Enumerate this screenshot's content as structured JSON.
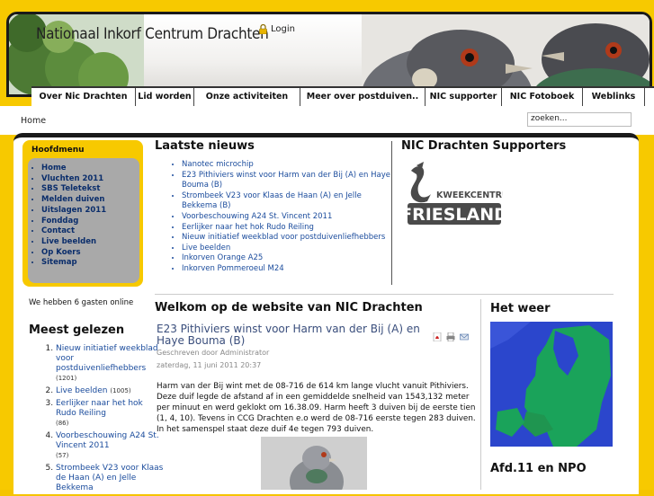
{
  "header": {
    "site_title": "Nationaal Inkorf Centrum Drachten",
    "login_label": "Login"
  },
  "nav": {
    "items": [
      {
        "label": "Over Nic Drachten"
      },
      {
        "label": "Lid worden"
      },
      {
        "label": "Onze activiteiten"
      },
      {
        "label": "Meer over postduiven.."
      },
      {
        "label": "NIC supporter"
      },
      {
        "label": "NIC Fotoboek"
      },
      {
        "label": "Weblinks"
      }
    ]
  },
  "breadcrumb": "Home",
  "search": {
    "value": "zoeken..."
  },
  "main_menu": {
    "title": "Hoofdmenu",
    "items": [
      "Home",
      "Vluchten 2011",
      "SBS Teletekst",
      "Melden duiven",
      "Uitslagen 2011",
      "Fonddag",
      "Contact",
      "Live beelden",
      "Op Koers",
      "Sitemap"
    ]
  },
  "guests_text": "We hebben 6 gasten online",
  "popular": {
    "title": "Meest gelezen",
    "items": [
      {
        "label": "Nieuw initiatief weekblad voor postduivenliefhebbers",
        "count": "(1201)"
      },
      {
        "label": "Live beelden",
        "count": "(1005)"
      },
      {
        "label": "Eerlijker naar het hok Rudo Reiling",
        "count": "(86)"
      },
      {
        "label": "Voorbeschouwing A24 St. Vincent 2011",
        "count": "(57)"
      },
      {
        "label": "Strombeek V23 voor Klaas de Haan (A) en Jelle Bekkema",
        "count": ""
      }
    ]
  },
  "latest_news": {
    "title": "Laatste nieuws",
    "items": [
      "Nanotec microchip",
      "E23 Pithiviers winst voor Harm van der Bij (A) en Haye Bouma (B)",
      "Strombeek V23 voor Klaas de Haan (A) en Jelle Bekkema (B)",
      "Voorbeschouwing A24 St. Vincent 2011",
      "Eerlijker naar het hok Rudo Reiling",
      "Nieuw initiatief weekblad voor postduivenliefhebbers",
      "Live beelden",
      "Inkorven Orange A25",
      "Inkorven Pommeroeul M24"
    ]
  },
  "supporters": {
    "title": "NIC Drachten Supporters",
    "logo_top": "KWEEKCENTRUM",
    "logo_bottom": "FRIESLAND"
  },
  "welcome": {
    "title": "Welkom op de website van NIC Drachten",
    "article_title": "E23 Pithiviers winst voor Harm van der Bij (A) en Haye Bouma (B)",
    "author": "Geschreven door Administrator",
    "date": "zaterdag, 11 juni 2011 20:37",
    "body": "Harm van der Bij wint met de 08-716 de 614 km lange vlucht vanuit Pithiviers. Deze duif legde de afstand af in een gemiddelde snelheid van 1543,132 meter per minuut en werd geklokt om 16.38.09. Harm heeft 3 duiven bij de eerste tien (1, 4, 10). Tevens in CCG Drachten e.o werd de 08-716 eerste tegen 283 duiven. In het samenspel staat deze duif 4e tegen 793 duiven."
  },
  "weather": {
    "title": "Het weer"
  },
  "afd": {
    "title": "Afd.11 en NPO"
  },
  "colors": {
    "accent": "#f7c900",
    "frame": "#1a1a1a",
    "link": "#1a4b9c",
    "menu_link": "#0a2d6b"
  }
}
